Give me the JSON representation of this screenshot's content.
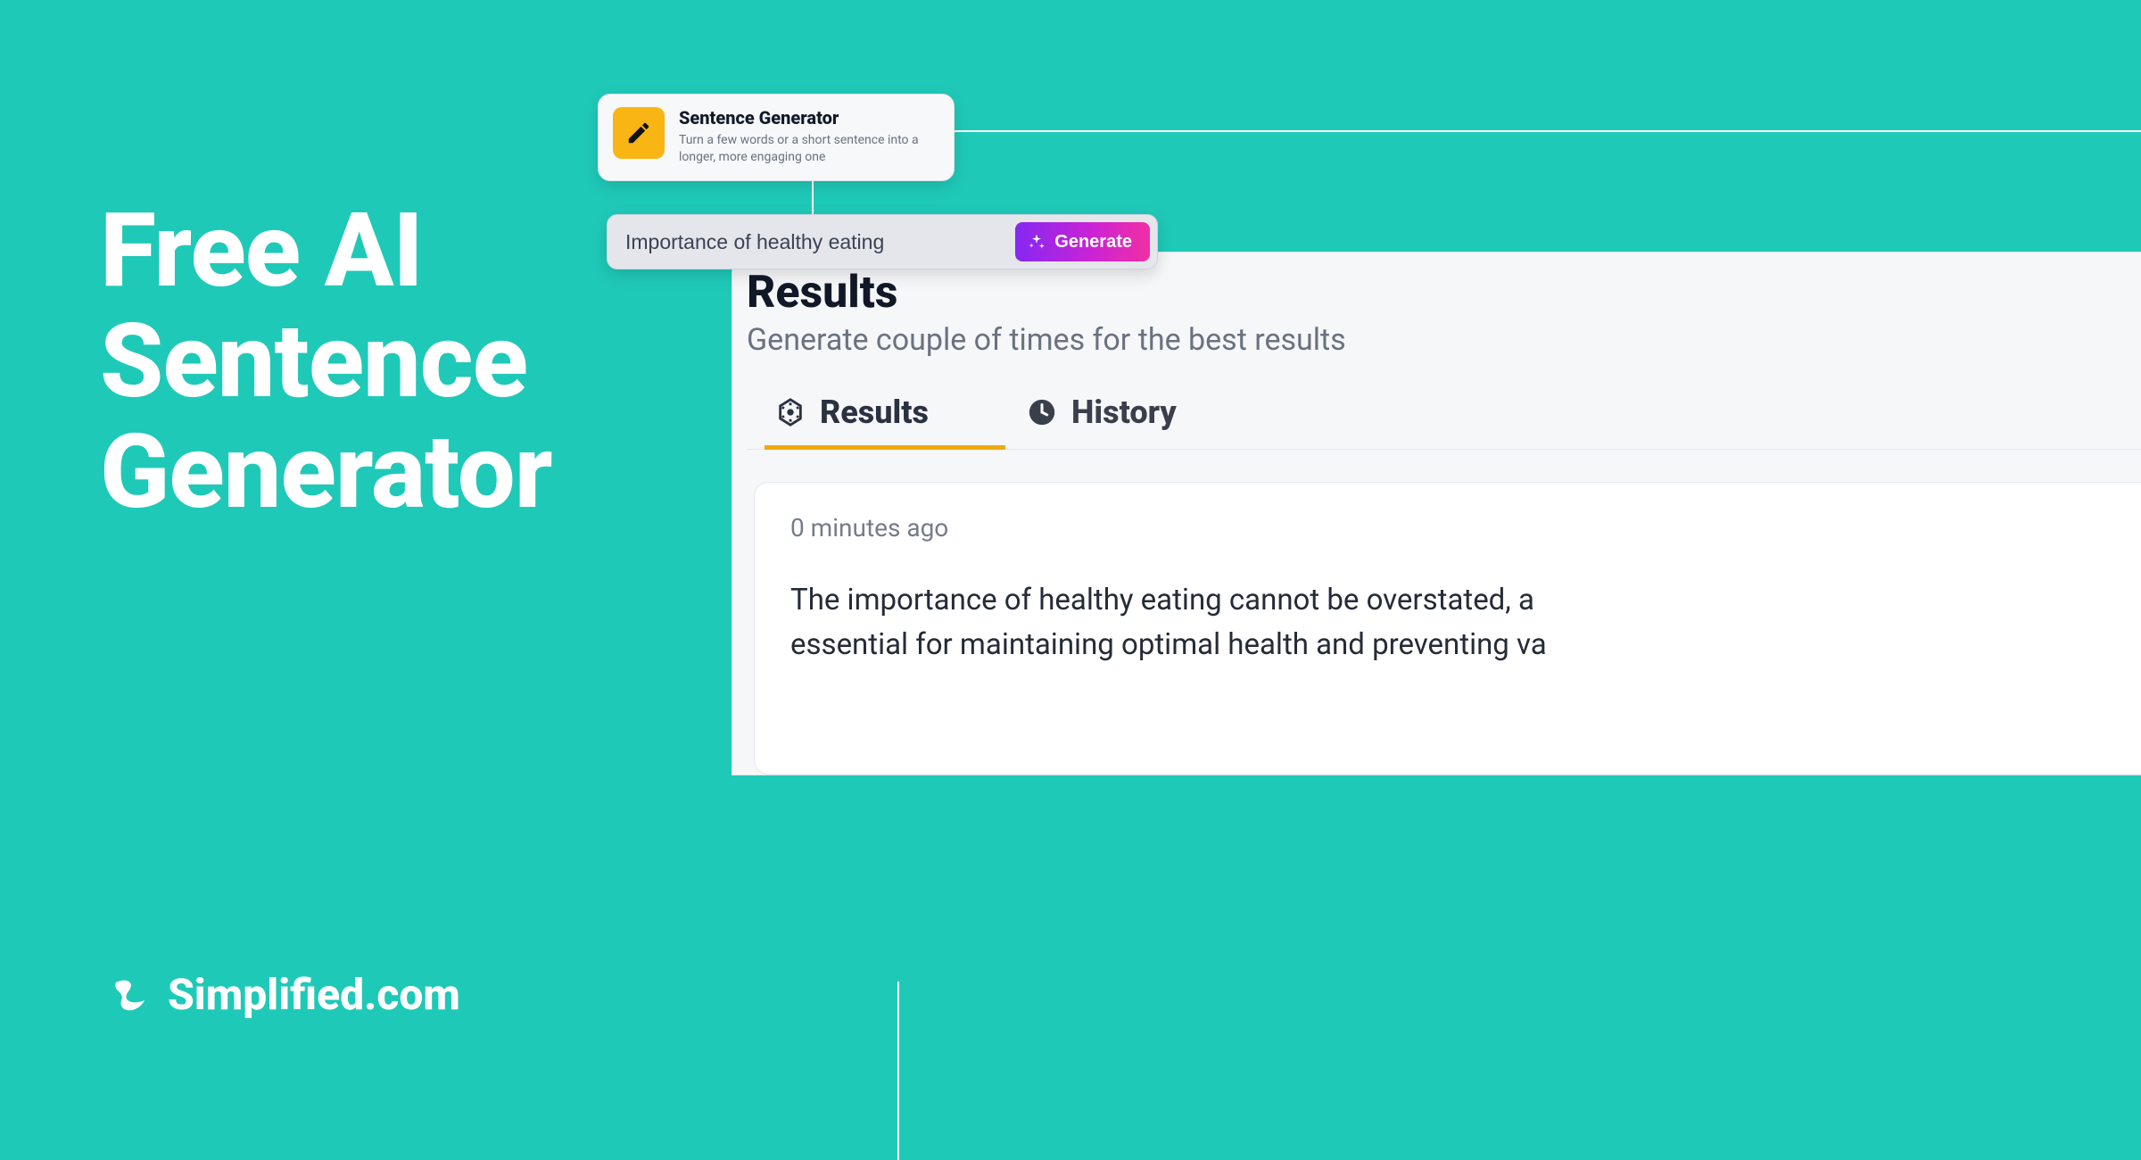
{
  "hero": {
    "line1": "Free AI",
    "line2": "Sentence",
    "line3": "Generator"
  },
  "brand": {
    "name": "Simplified.com"
  },
  "tool": {
    "title": "Sentence Generator",
    "description": "Turn a few words or a short sentence into a longer, more engaging one"
  },
  "input": {
    "value": "Importance of healthy eating",
    "button": "Generate"
  },
  "results": {
    "heading": "Results",
    "sub": "Generate couple of times for the best results",
    "tabs": {
      "results": "Results",
      "history": "History"
    },
    "card": {
      "time": "0 minutes ago",
      "line1": "The importance of healthy eating cannot be overstated, a",
      "line2": "essential for maintaining optimal health and preventing va"
    }
  }
}
